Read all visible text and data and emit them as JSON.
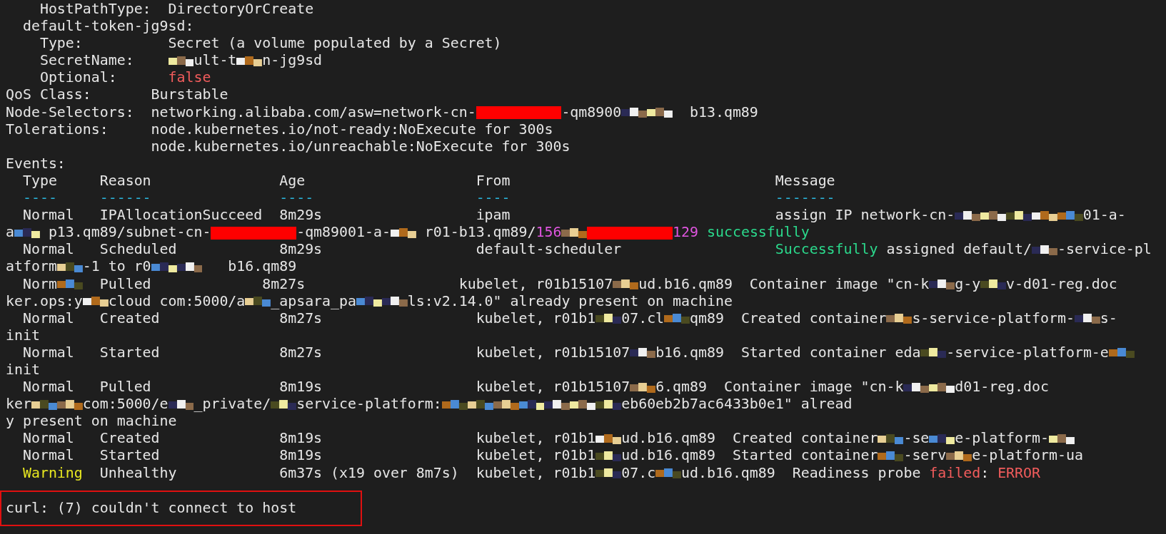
{
  "terminal": {
    "lines": [
      {
        "segments": [
          {
            "kind": "text",
            "text": "    HostPathType:  DirectoryOrCreate"
          }
        ]
      },
      {
        "segments": [
          {
            "kind": "text",
            "text": "  default-token-jg9sd:"
          }
        ]
      },
      {
        "segments": [
          {
            "kind": "text",
            "text": "    Type:          Secret (a volume populated by a Secret)"
          }
        ]
      },
      {
        "segments": [
          {
            "kind": "text",
            "text": "    SecretName:    "
          },
          {
            "kind": "mosaic"
          },
          {
            "kind": "text",
            "text": "ult-t"
          },
          {
            "kind": "mosaic"
          },
          {
            "kind": "text",
            "text": "n-jg9sd"
          }
        ]
      },
      {
        "segments": [
          {
            "kind": "text",
            "text": "    Optional:      "
          },
          {
            "kind": "error",
            "text": "false"
          }
        ]
      },
      {
        "segments": [
          {
            "kind": "text",
            "text": "QoS Class:       Burstable"
          }
        ]
      },
      {
        "segments": [
          {
            "kind": "text",
            "text": "Node-Selectors:  networking.alibaba.com/asw=network-cn-"
          },
          {
            "kind": "redbar"
          },
          {
            "kind": "text",
            "text": "-qm8900"
          },
          {
            "kind": "mosaic"
          },
          {
            "kind": "mosaic"
          },
          {
            "kind": "text",
            "text": "  b13.qm89"
          }
        ]
      },
      {
        "segments": [
          {
            "kind": "text",
            "text": "Tolerations:     node.kubernetes.io/not-ready:NoExecute for 300s"
          }
        ]
      },
      {
        "segments": [
          {
            "kind": "text",
            "text": "                 node.kubernetes.io/unreachable:NoExecute for 300s"
          }
        ]
      },
      {
        "segments": [
          {
            "kind": "text",
            "text": "Events:"
          }
        ]
      },
      {
        "segments": [
          {
            "kind": "text",
            "text": "  Type     Reason               Age                    From                               Message"
          }
        ]
      },
      {
        "segments": [
          {
            "kind": "divider",
            "text": "  ----     ------               ----                   ----                               -------"
          }
        ]
      },
      {
        "segments": [
          {
            "kind": "text",
            "text": "  Normal   IPAllocationSucceed  8m29s                  ipam                               assign IP network-cn-"
          },
          {
            "kind": "mosaic"
          },
          {
            "kind": "mosaic"
          },
          {
            "kind": "mosaic"
          },
          {
            "kind": "mosaic"
          },
          {
            "kind": "mosaic"
          },
          {
            "kind": "text",
            "text": "01-a-"
          }
        ]
      },
      {
        "segments": [
          {
            "kind": "text",
            "text": "a"
          },
          {
            "kind": "mosaic"
          },
          {
            "kind": "text",
            "text": " p13.qm89/subnet-cn-"
          },
          {
            "kind": "redbar"
          },
          {
            "kind": "text",
            "text": "-qm89001-a-"
          },
          {
            "kind": "mosaic"
          },
          {
            "kind": "text",
            "text": " r01-b13.qm89/"
          },
          {
            "kind": "ip",
            "text": "156"
          },
          {
            "kind": "mosaic"
          },
          {
            "kind": "redbar"
          },
          {
            "kind": "ip",
            "text": "129"
          },
          {
            "kind": "success",
            "text": " successfully"
          }
        ]
      },
      {
        "segments": [
          {
            "kind": "text",
            "text": "  Normal   Scheduled            8m29s                  default-scheduler                  "
          },
          {
            "kind": "success",
            "text": "Successfully"
          },
          {
            "kind": "text",
            "text": " assigned default/"
          },
          {
            "kind": "mosaic"
          },
          {
            "kind": "text",
            "text": "-service-pl"
          }
        ]
      },
      {
        "segments": [
          {
            "kind": "text",
            "text": "atform"
          },
          {
            "kind": "mosaic"
          },
          {
            "kind": "text",
            "text": "-1 to r0"
          },
          {
            "kind": "mosaic"
          },
          {
            "kind": "mosaic"
          },
          {
            "kind": "text",
            "text": "   b16.qm89"
          }
        ]
      },
      {
        "segments": [
          {
            "kind": "text",
            "text": "  Norm"
          },
          {
            "kind": "mosaic"
          },
          {
            "kind": "text",
            "text": "  Pulled             8m27s                  kubelet, r01b15107"
          },
          {
            "kind": "mosaic"
          },
          {
            "kind": "text",
            "text": "ud.b16.qm89  Container image \"cn-k"
          },
          {
            "kind": "mosaic"
          },
          {
            "kind": "text",
            "text": "g-y"
          },
          {
            "kind": "mosaic"
          },
          {
            "kind": "text",
            "text": "v-d01-reg.doc"
          }
        ]
      },
      {
        "segments": [
          {
            "kind": "text",
            "text": "ker.ops:y"
          },
          {
            "kind": "mosaic"
          },
          {
            "kind": "text",
            "text": "cloud com:5000/a"
          },
          {
            "kind": "mosaic"
          },
          {
            "kind": "text",
            "text": "_apsara_pa"
          },
          {
            "kind": "mosaic"
          },
          {
            "kind": "mosaic"
          },
          {
            "kind": "text",
            "text": "ls:v2.14.0\" already present on machine"
          }
        ]
      },
      {
        "segments": [
          {
            "kind": "text",
            "text": "  Normal   Created              8m27s                  kubelet, r01b1"
          },
          {
            "kind": "mosaic"
          },
          {
            "kind": "text",
            "text": "07.cl"
          },
          {
            "kind": "mosaic"
          },
          {
            "kind": "text",
            "text": "qm89  Created container"
          },
          {
            "kind": "mosaic"
          },
          {
            "kind": "text",
            "text": "s-service-platform-"
          },
          {
            "kind": "mosaic"
          },
          {
            "kind": "text",
            "text": "s-"
          }
        ]
      },
      {
        "segments": [
          {
            "kind": "text",
            "text": "init"
          }
        ]
      },
      {
        "segments": [
          {
            "kind": "text",
            "text": "  Normal   Started              8m27s                  kubelet, r01b15107"
          },
          {
            "kind": "mosaic"
          },
          {
            "kind": "text",
            "text": "b16.qm89  Started container eda"
          },
          {
            "kind": "mosaic"
          },
          {
            "kind": "text",
            "text": "-service-platform-e"
          },
          {
            "kind": "mosaic"
          }
        ]
      },
      {
        "segments": [
          {
            "kind": "text",
            "text": "init"
          }
        ]
      },
      {
        "segments": [
          {
            "kind": "text",
            "text": "  Normal   Pulled               8m19s                  kubelet, r01b15107"
          },
          {
            "kind": "mosaic"
          },
          {
            "kind": "text",
            "text": "6.qm89  Container image \"cn-k"
          },
          {
            "kind": "mosaic"
          },
          {
            "kind": "mosaic"
          },
          {
            "kind": "text",
            "text": "d01-reg.doc"
          }
        ]
      },
      {
        "segments": [
          {
            "kind": "text",
            "text": "ker"
          },
          {
            "kind": "mosaic"
          },
          {
            "kind": "mosaic"
          },
          {
            "kind": "text",
            "text": "com:5000/e"
          },
          {
            "kind": "mosaic"
          },
          {
            "kind": "text",
            "text": "_private/"
          },
          {
            "kind": "mosaic"
          },
          {
            "kind": "text",
            "text": "service-platform:"
          },
          {
            "kind": "mosaic"
          },
          {
            "kind": "mosaic"
          },
          {
            "kind": "mosaic"
          },
          {
            "kind": "mosaic"
          },
          {
            "kind": "mosaic"
          },
          {
            "kind": "mosaic"
          },
          {
            "kind": "mosaic"
          },
          {
            "kind": "text",
            "text": "eb60eb2b7ac6433b0e1\" alread"
          }
        ]
      },
      {
        "segments": [
          {
            "kind": "text",
            "text": "y present on machine"
          }
        ]
      },
      {
        "segments": [
          {
            "kind": "text",
            "text": "  Normal   Created              8m19s                  kubelet, r01b1"
          },
          {
            "kind": "mosaic"
          },
          {
            "kind": "text",
            "text": "ud.b16.qm89  Created container"
          },
          {
            "kind": "mosaic"
          },
          {
            "kind": "text",
            "text": "-se"
          },
          {
            "kind": "mosaic"
          },
          {
            "kind": "text",
            "text": "e-platform-"
          },
          {
            "kind": "mosaic"
          }
        ]
      },
      {
        "segments": [
          {
            "kind": "text",
            "text": "  Normal   Started              8m19s                  kubelet, r01b1"
          },
          {
            "kind": "mosaic"
          },
          {
            "kind": "text",
            "text": "ud.b16.qm89  Started container"
          },
          {
            "kind": "mosaic"
          },
          {
            "kind": "text",
            "text": "-serv"
          },
          {
            "kind": "mosaic"
          },
          {
            "kind": "text",
            "text": "e-platform-ua"
          }
        ]
      },
      {
        "segments": [
          {
            "kind": "warning",
            "text": "  Warning"
          },
          {
            "kind": "text",
            "text": "  Unhealthy            6m37s (x19 over 8m7s)  kubelet, r01b1"
          },
          {
            "kind": "mosaic"
          },
          {
            "kind": "text",
            "text": "07.c"
          },
          {
            "kind": "mosaic"
          },
          {
            "kind": "text",
            "text": "ud.b16.qm89  Readiness probe "
          },
          {
            "kind": "error",
            "text": "failed"
          },
          {
            "kind": "text",
            "text": ": "
          },
          {
            "kind": "error",
            "text": "ERROR"
          }
        ]
      }
    ],
    "highlighted_line": {
      "segments": [
        {
          "kind": "text",
          "text": "curl: (7) couldn't connect to host"
        }
      ]
    }
  }
}
